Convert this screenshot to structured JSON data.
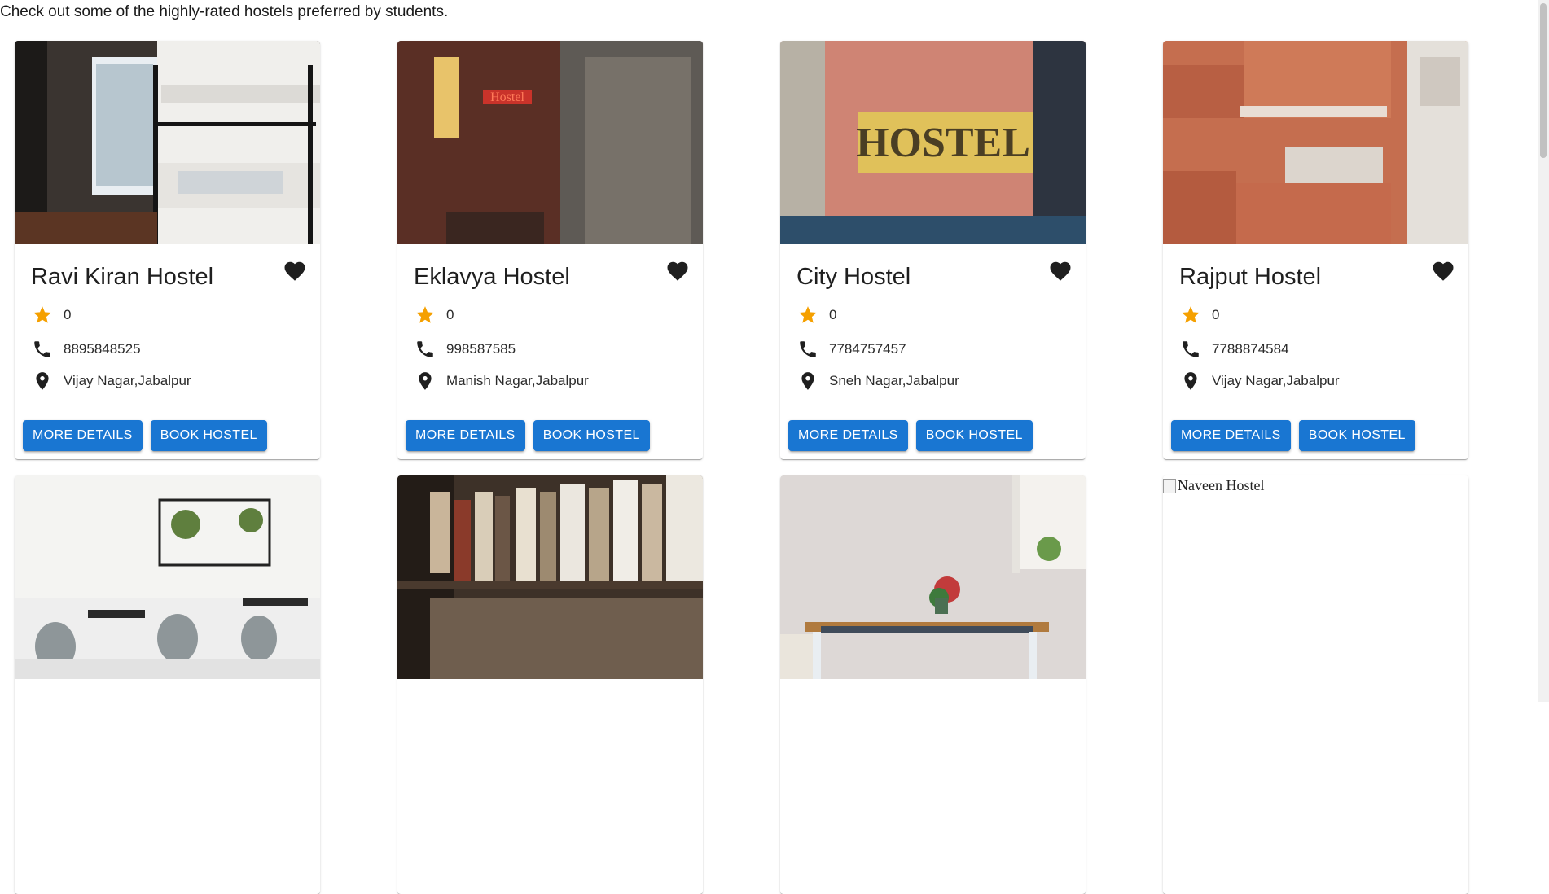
{
  "intro": "Check out some of the highly-rated hostels preferred by students.",
  "colors": {
    "accent": "#1976d2",
    "star": "#f5a000"
  },
  "cards": [
    {
      "name": "Ravi Kiran Hostel",
      "rating": "0",
      "phone": "8895848525",
      "address": "Vijay Nagar,Jabalpur",
      "image": "bunk-bed-room-photo"
    },
    {
      "name": "Eklavya Hostel",
      "rating": "0",
      "phone": "998587585",
      "address": "Manish Nagar,Jabalpur",
      "image": "neon-hostel-alley-photo"
    },
    {
      "name": "City Hostel",
      "rating": "0",
      "phone": "7784757457",
      "address": "Sneh Nagar,Jabalpur",
      "image": "hostel-sign-photo"
    },
    {
      "name": "Rajput Hostel",
      "rating": "0",
      "phone": "7788874584",
      "address": "Vijay Nagar,Jabalpur",
      "image": "brick-balconies-photo"
    },
    {
      "image": "white-cafe-interior-photo"
    },
    {
      "image": "bookshelf-photo"
    },
    {
      "image": "dining-table-window-photo"
    },
    {
      "image_alt": "Naveen Hostel"
    }
  ],
  "buttons": {
    "more_details": "MORE DETAILS",
    "book_hostel": "BOOK HOSTEL"
  },
  "icons": {
    "favorite": "heart-icon",
    "rating": "star-icon",
    "phone": "phone-icon",
    "address": "location-pin-icon"
  }
}
